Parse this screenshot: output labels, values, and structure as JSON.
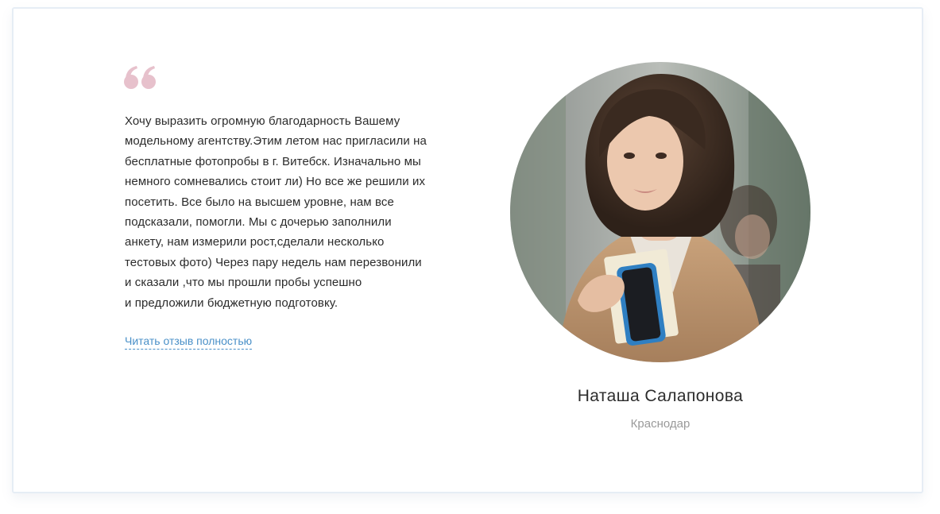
{
  "review": {
    "lines": [
      "Хочу выразить огромную благодарность Вашему",
      "модельному агентству.Этим летом нас пригласили на",
      "бесплатные фотопробы в г. Витебск. Изначально мы",
      "немного сомневались стоит ли) Но все же решили их",
      "посетить. Все было на высшем уровне, нам все",
      "подсказали, помогли. Мы с дочерью заполнили",
      "анкету, нам измерили рост,сделали несколько",
      "тестовых фото) Через пару недель нам перезвонили",
      "и сказали ,что мы прошли пробы успешно",
      "и предложили бюджетную подготовку."
    ],
    "read_more_label": "Читать отзыв полностью"
  },
  "author": {
    "name": "Наташа Салапонова",
    "city": "Краснодар"
  },
  "icons": {
    "quote": "quote-icon",
    "avatar": "avatar-photo"
  },
  "colors": {
    "quote_mark": "#e7c1cc",
    "link": "#4a90c8",
    "text": "#2b2b2b",
    "muted": "#9a9a9a",
    "card_border": "#e6edf5"
  }
}
